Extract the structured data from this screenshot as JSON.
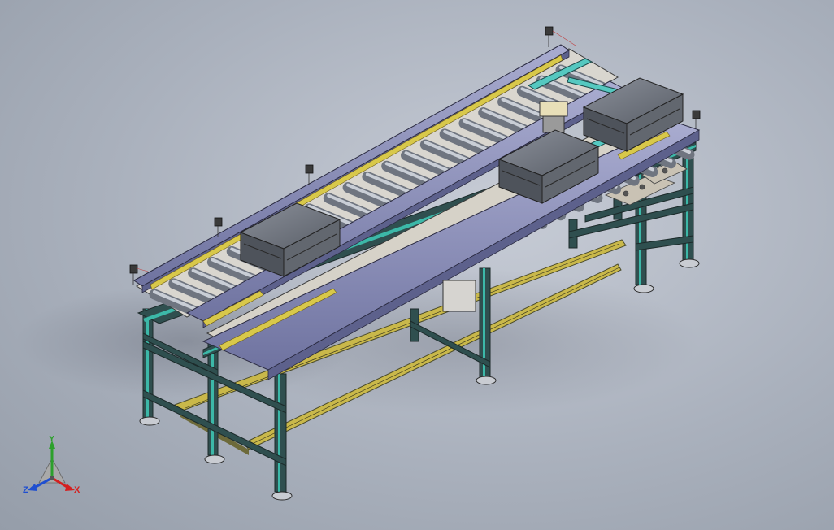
{
  "viewport": {
    "model": "roller-conveyor-assembly",
    "background_colors": [
      "#c7ccd6",
      "#959da9"
    ],
    "colors": {
      "frame": "#2f4f4f",
      "frame_accent": "#3cb8a8",
      "side_rail": "#8c8fb8",
      "roller": "#9aa0ab",
      "guide_strip": "#d8c84a",
      "bin": "#6a6f78",
      "mount_plate": "#c9c2b4"
    }
  },
  "triad": {
    "y_label": "Y",
    "z_label": "Z",
    "x_label": "X",
    "colors": {
      "y": "#2ca02c",
      "z": "#1f4fd0",
      "x": "#d42020"
    }
  }
}
